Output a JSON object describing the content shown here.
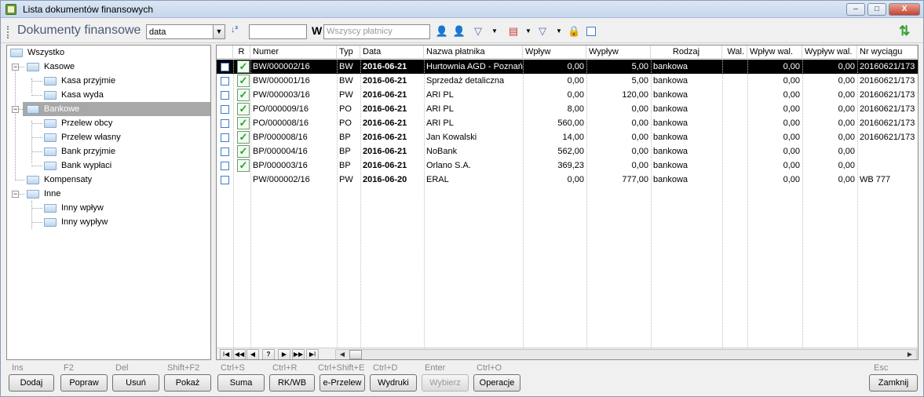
{
  "window": {
    "title": "Lista dokumentów finansowych",
    "min_label": "–",
    "max_label": "□",
    "close_label": "X"
  },
  "toolbar": {
    "title": "Dokumenty finansowe",
    "sort_value": "data",
    "w_label": "W",
    "payer_placeholder": "Wszyscy płatnicy",
    "filter_value": ""
  },
  "tree": [
    {
      "label": "Wszystko"
    },
    {
      "label": "Kasowe"
    },
    {
      "label": "Kasa przyjmie"
    },
    {
      "label": "Kasa wyda"
    },
    {
      "label": "Bankowe"
    },
    {
      "label": "Przelew obcy"
    },
    {
      "label": "Przelew własny"
    },
    {
      "label": "Bank przyjmie"
    },
    {
      "label": "Bank wypłaci"
    },
    {
      "label": "Kompensaty"
    },
    {
      "label": "Inne"
    },
    {
      "label": "Inny wpływ"
    },
    {
      "label": "Inny wypływ"
    }
  ],
  "grid": {
    "columns": [
      "R",
      "Numer",
      "Typ",
      "Data",
      "Nazwa płatnika",
      "Wpływ",
      "Wypływ",
      "Rodzaj",
      "Wal.",
      "Wpływ wal.",
      "Wypływ wal.",
      "Nr wyciągu"
    ],
    "rows": [
      {
        "checked": true,
        "numer": "BW/000002/16",
        "typ": "BW",
        "data": "2016-06-21",
        "platnik": "Hurtownia AGD - Poznań",
        "wplyw": "0,00",
        "wyplyw": "5,00",
        "rodzaj": "bankowa",
        "wal": "",
        "wplyw_wal": "0,00",
        "wyplyw_wal": "0,00",
        "nr_wyciagu": "20160621/173"
      },
      {
        "checked": true,
        "numer": "BW/000001/16",
        "typ": "BW",
        "data": "2016-06-21",
        "platnik": "Sprzedaż detaliczna",
        "wplyw": "0,00",
        "wyplyw": "5,00",
        "rodzaj": "bankowa",
        "wal": "",
        "wplyw_wal": "0,00",
        "wyplyw_wal": "0,00",
        "nr_wyciagu": "20160621/173"
      },
      {
        "checked": true,
        "numer": "PW/000003/16",
        "typ": "PW",
        "data": "2016-06-21",
        "platnik": "ARI PL",
        "wplyw": "0,00",
        "wyplyw": "120,00",
        "rodzaj": "bankowa",
        "wal": "",
        "wplyw_wal": "0,00",
        "wyplyw_wal": "0,00",
        "nr_wyciagu": "20160621/173"
      },
      {
        "checked": true,
        "numer": "PO/000009/16",
        "typ": "PO",
        "data": "2016-06-21",
        "platnik": "ARI PL",
        "wplyw": "8,00",
        "wyplyw": "0,00",
        "rodzaj": "bankowa",
        "wal": "",
        "wplyw_wal": "0,00",
        "wyplyw_wal": "0,00",
        "nr_wyciagu": "20160621/173"
      },
      {
        "checked": true,
        "numer": "PO/000008/16",
        "typ": "PO",
        "data": "2016-06-21",
        "platnik": "ARI PL",
        "wplyw": "560,00",
        "wyplyw": "0,00",
        "rodzaj": "bankowa",
        "wal": "",
        "wplyw_wal": "0,00",
        "wyplyw_wal": "0,00",
        "nr_wyciagu": "20160621/173"
      },
      {
        "checked": true,
        "numer": "BP/000008/16",
        "typ": "BP",
        "data": "2016-06-21",
        "platnik": "Jan Kowalski",
        "wplyw": "14,00",
        "wyplyw": "0,00",
        "rodzaj": "bankowa",
        "wal": "",
        "wplyw_wal": "0,00",
        "wyplyw_wal": "0,00",
        "nr_wyciagu": "20160621/173"
      },
      {
        "checked": true,
        "numer": "BP/000004/16",
        "typ": "BP",
        "data": "2016-06-21",
        "platnik": "NoBank",
        "wplyw": "562,00",
        "wyplyw": "0,00",
        "rodzaj": "bankowa",
        "wal": "",
        "wplyw_wal": "0,00",
        "wyplyw_wal": "0,00",
        "nr_wyciagu": ""
      },
      {
        "checked": true,
        "numer": "BP/000003/16",
        "typ": "BP",
        "data": "2016-06-21",
        "platnik": "Orlano S.A.",
        "wplyw": "369,23",
        "wyplyw": "0,00",
        "rodzaj": "bankowa",
        "wal": "",
        "wplyw_wal": "0,00",
        "wyplyw_wal": "0,00",
        "nr_wyciagu": ""
      },
      {
        "checked": false,
        "numer": "PW/000002/16",
        "typ": "PW",
        "data": "2016-06-20",
        "platnik": "ERAL",
        "wplyw": "0,00",
        "wyplyw": "777,00",
        "rodzaj": "bankowa",
        "wal": "",
        "wplyw_wal": "0,00",
        "wyplyw_wal": "0,00",
        "nr_wyciagu": "WB 777"
      }
    ]
  },
  "nav": {
    "first": "I◀",
    "prev_page": "◀◀",
    "prev": "◀",
    "goto": "?",
    "next": "▶",
    "next_page": "▶▶",
    "last": "▶I"
  },
  "buttons": [
    {
      "hotkey": "Ins",
      "label": "Dodaj"
    },
    {
      "hotkey": "F2",
      "label": "Popraw"
    },
    {
      "hotkey": "Del",
      "label": "Usuń"
    },
    {
      "hotkey": "Shift+F2",
      "label": "Pokaż"
    },
    {
      "hotkey": "Ctrl+S",
      "label": "Suma"
    },
    {
      "hotkey": "Ctrl+R",
      "label": "RK/WB"
    },
    {
      "hotkey": "Ctrl+Shift+E",
      "label": "e-Przelew"
    },
    {
      "hotkey": "Ctrl+D",
      "label": "Wydruki"
    },
    {
      "hotkey": "Enter",
      "label": "Wybierz"
    },
    {
      "hotkey": "Ctrl+O",
      "label": "Operacje"
    },
    {
      "hotkey": "Esc",
      "label": "Zamknij"
    }
  ],
  "icons": [
    "app-icon",
    "sort-order-icon",
    "payer-icon",
    "payer-add-icon",
    "filter-icon",
    "dropdown-icon",
    "calendar-icon",
    "filter-edit-icon",
    "lock-icon",
    "checkbox-icon",
    "refresh-icon"
  ]
}
